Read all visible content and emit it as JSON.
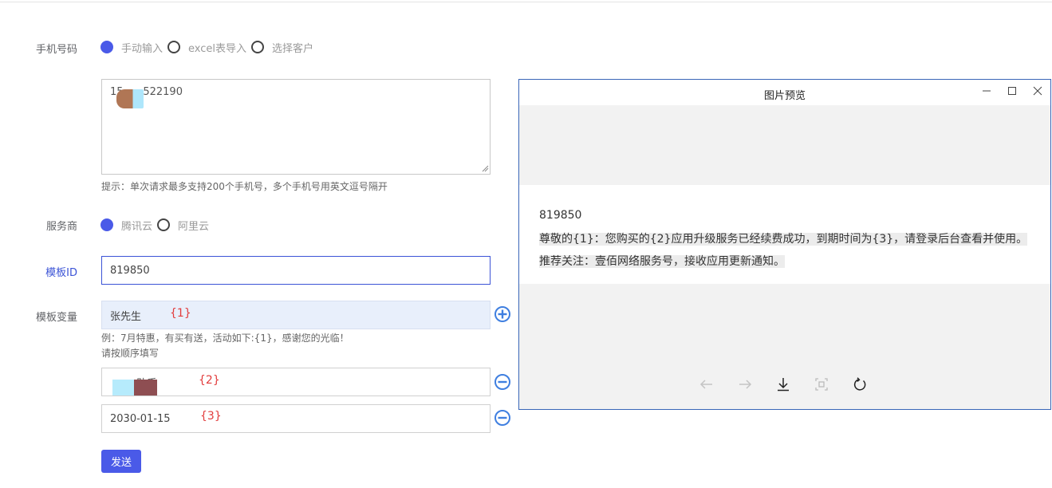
{
  "form": {
    "phone": {
      "label": "手机号码",
      "options": [
        "手动输入",
        "excel表导入",
        "选择客户"
      ],
      "selected": 0,
      "textarea_value": "15      522190",
      "hint": "提示：单次请求最多支持200个手机号，多个手机号用英文逗号隔开"
    },
    "provider": {
      "label": "服务商",
      "options": [
        "腾讯云",
        "阿里云"
      ],
      "selected": 0
    },
    "template_id": {
      "label": "模板ID",
      "value": "819850"
    },
    "template_vars": {
      "label": "模板变量",
      "items": [
        {
          "value": "张先生",
          "tag": "{1}"
        },
        {
          "value": "        助手",
          "tag": "{2}"
        },
        {
          "value": "2030-01-15",
          "tag": "{3}"
        }
      ],
      "example": "例：7月特惠，有买有送，活动如下:{1}，感谢您的光临！",
      "order_hint": "请按顺序填写"
    },
    "send_label": "发送"
  },
  "preview": {
    "title": "图片预览",
    "line1": "819850",
    "body": "尊敬的{1}：您购买的{2}应用升级服务已经续费成功，到期时间为{3}，请登录后台查看并使用。推荐关注：壹佰网络服务号，接收应用更新通知。"
  },
  "colors": {
    "accent": "#4a5ae8",
    "var_tag": "#e23b3b",
    "window_border": "#3a66b8"
  }
}
